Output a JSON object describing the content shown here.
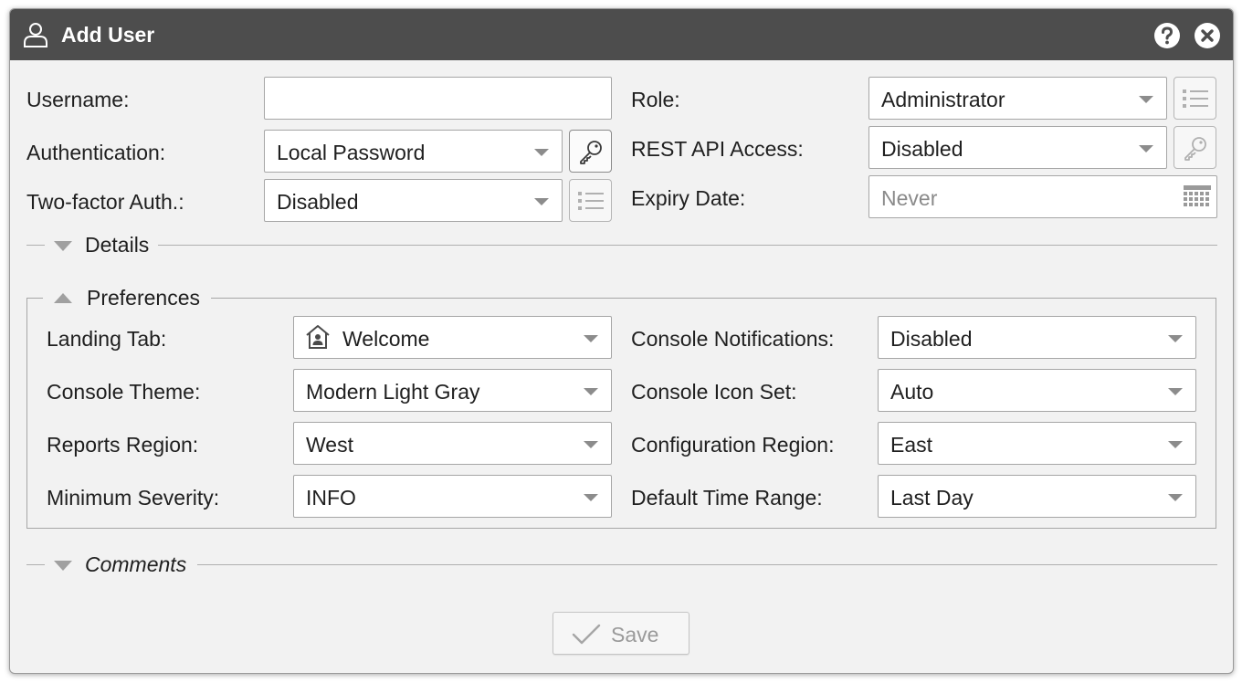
{
  "dialog": {
    "title": "Add User",
    "icons": {
      "user": "user-icon",
      "help": "help-icon",
      "close": "close-icon"
    }
  },
  "top_left": {
    "username": {
      "label": "Username:",
      "value": ""
    },
    "authentication": {
      "label": "Authentication:",
      "value": "Local Password",
      "side_icon": "key-icon"
    },
    "two_factor": {
      "label": "Two-factor Auth.:",
      "value": "Disabled",
      "side_icon": "list-icon"
    }
  },
  "top_right": {
    "role": {
      "label": "Role:",
      "value": "Administrator",
      "side_icon": "list-icon"
    },
    "rest_api": {
      "label": "REST API Access:",
      "value": "Disabled",
      "side_icon": "key-icon"
    },
    "expiry": {
      "label": "Expiry Date:",
      "value": "Never",
      "side_icon": "calendar-icon"
    }
  },
  "sections": {
    "details": {
      "title": "Details",
      "expanded": false
    },
    "preferences": {
      "title": "Preferences",
      "expanded": true
    },
    "comments": {
      "title": "Comments",
      "expanded": false
    }
  },
  "preferences": {
    "landing_tab": {
      "label": "Landing Tab:",
      "value": "Welcome",
      "icon": "home-icon"
    },
    "console_theme": {
      "label": "Console Theme:",
      "value": "Modern Light Gray"
    },
    "reports_region": {
      "label": "Reports Region:",
      "value": "West"
    },
    "minimum_severity": {
      "label": "Minimum Severity:",
      "value": "INFO"
    },
    "console_notifications": {
      "label": "Console Notifications:",
      "value": "Disabled"
    },
    "console_icon_set": {
      "label": "Console Icon Set:",
      "value": "Auto"
    },
    "configuration_region": {
      "label": "Configuration Region:",
      "value": "East"
    },
    "default_time_range": {
      "label": "Default Time Range:",
      "value": "Last Day"
    }
  },
  "footer": {
    "save_label": "Save",
    "save_icon": "check-icon"
  },
  "colors": {
    "titlebar": "#4d4d4d",
    "dialog_bg": "#f2f2f2",
    "field_border": "#a6a6a6",
    "disabled_text": "#9a9a9a"
  }
}
